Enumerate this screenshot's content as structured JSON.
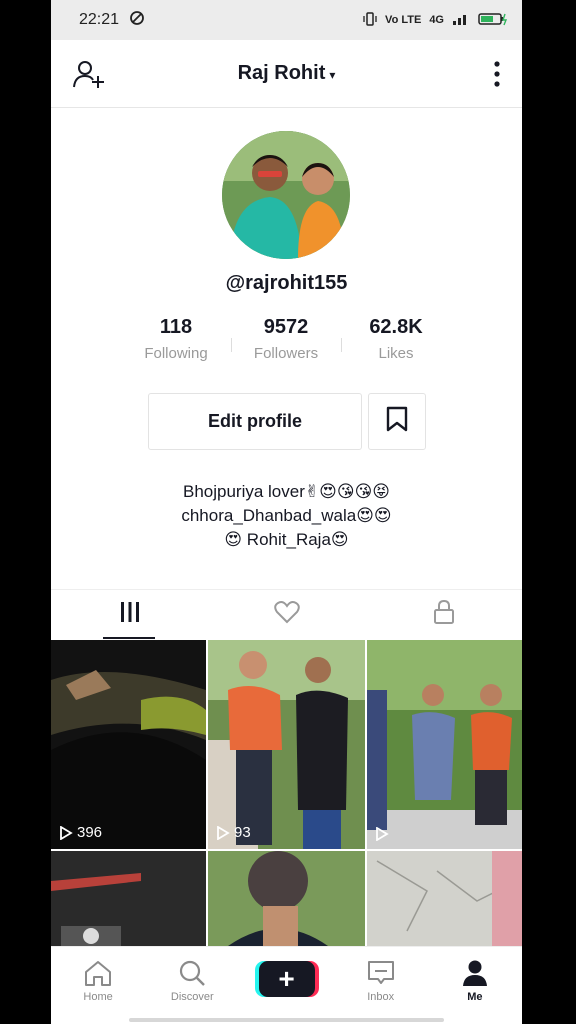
{
  "status": {
    "time": "22:21",
    "network": "4G",
    "volte": "Vo LTE"
  },
  "header": {
    "title": "Raj Rohit",
    "caret": "▾"
  },
  "profile": {
    "username": "@rajrohit155",
    "stats": [
      {
        "value": "118",
        "label": "Following"
      },
      {
        "value": "9572",
        "label": "Followers"
      },
      {
        "value": "62.8K",
        "label": "Likes"
      }
    ],
    "edit_label": "Edit profile",
    "bio": [
      "Bhojpuriya lover✌😍😘😘😝",
      "chhora_Dhanbad_wala😍😍",
      "😍 Rohit_Raja😍"
    ]
  },
  "videos": [
    {
      "views": "396"
    },
    {
      "views": "93"
    },
    {
      "views": ""
    }
  ],
  "nav": {
    "home": "Home",
    "discover": "Discover",
    "create": "+",
    "inbox": "Inbox",
    "me": "Me"
  },
  "colors": {
    "accent_cyan": "#25f4ee",
    "accent_red": "#fe2c55",
    "text": "#161823"
  }
}
